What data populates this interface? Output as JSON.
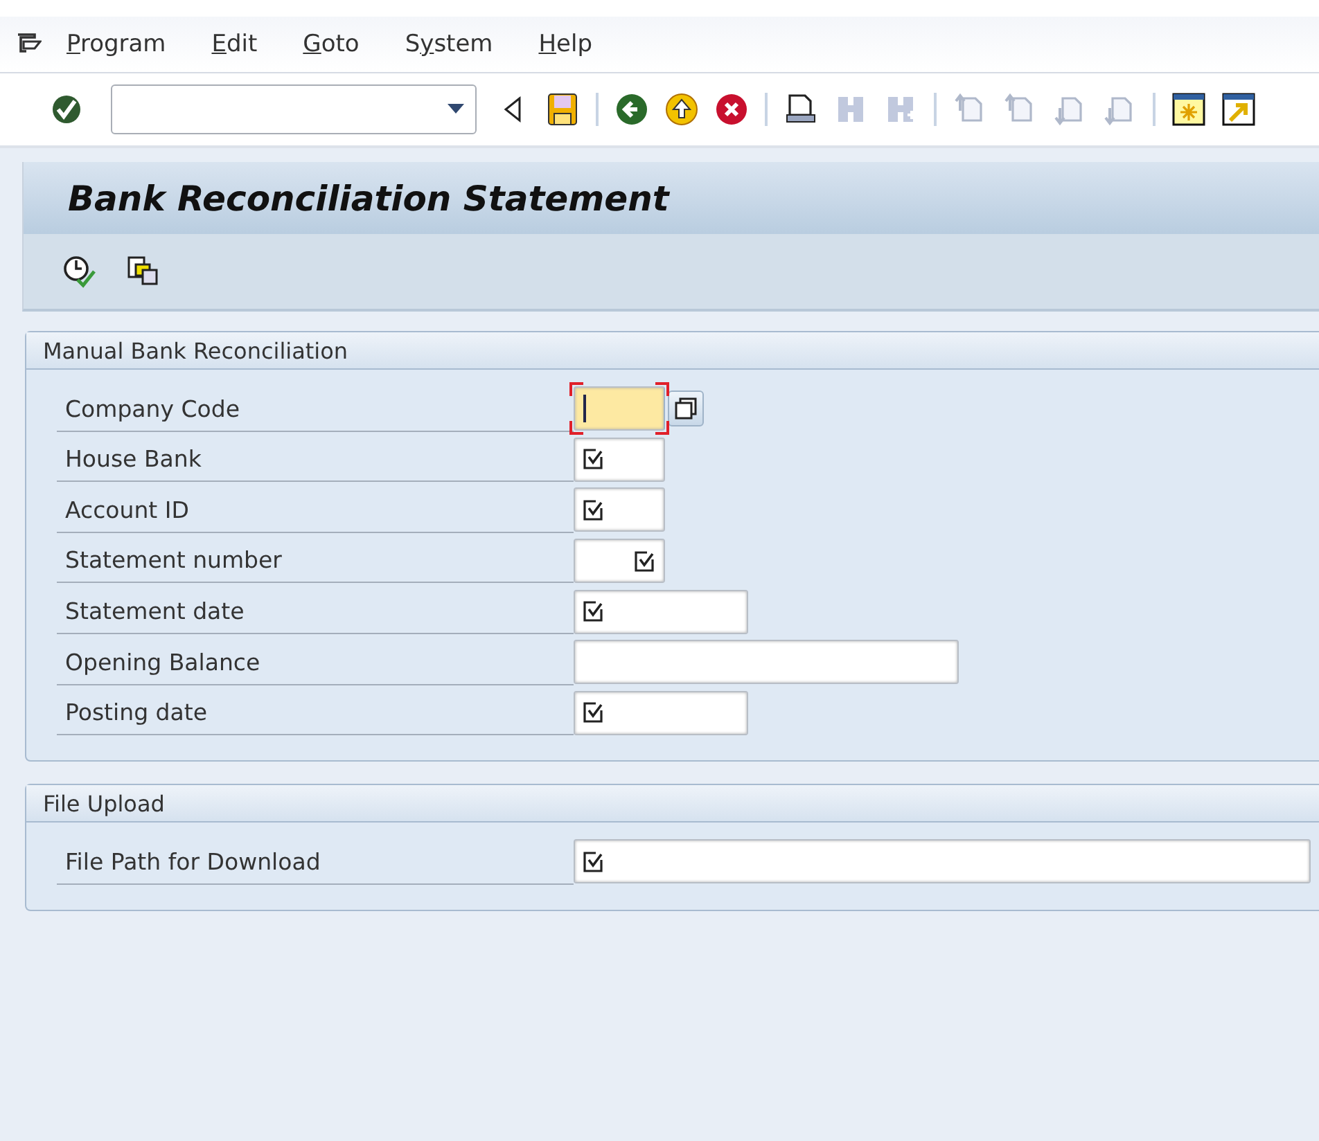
{
  "menu": [
    {
      "key": "P",
      "after": "rogram"
    },
    {
      "key": "E",
      "after": "dit"
    },
    {
      "key": "G",
      "after": "oto"
    },
    {
      "before": "S",
      "key": "y",
      "after": "stem"
    },
    {
      "key": "H",
      "after": "elp"
    }
  ],
  "toolbar": {
    "buttons": [
      {
        "kind": "enter",
        "disabled": false
      },
      {
        "kind": "field"
      },
      {
        "kind": "back-arrow",
        "disabled": false
      },
      {
        "kind": "save",
        "disabled": false
      },
      {
        "kind": "sep"
      },
      {
        "kind": "back",
        "disabled": false
      },
      {
        "kind": "exit",
        "disabled": false
      },
      {
        "kind": "cancel",
        "disabled": false
      },
      {
        "kind": "sep"
      },
      {
        "kind": "print",
        "disabled": false
      },
      {
        "kind": "find",
        "disabled": true
      },
      {
        "kind": "find-next",
        "disabled": true
      },
      {
        "kind": "sep"
      },
      {
        "kind": "first",
        "disabled": true
      },
      {
        "kind": "prev",
        "disabled": true
      },
      {
        "kind": "next",
        "disabled": true
      },
      {
        "kind": "last",
        "disabled": true
      },
      {
        "kind": "sep"
      },
      {
        "kind": "new-session",
        "disabled": false
      },
      {
        "kind": "shortcut",
        "disabled": false
      }
    ]
  },
  "title": "Bank Reconciliation Statement",
  "app_toolbar": [
    {
      "kind": "execute"
    },
    {
      "kind": "variants"
    }
  ],
  "groups": [
    {
      "title": "Manual Bank Reconciliation",
      "fields": [
        {
          "label": "Company Code",
          "kind": "short",
          "required": false,
          "focused": true,
          "value_help": true
        },
        {
          "label": "House Bank",
          "kind": "short",
          "required": true,
          "focused": false,
          "value_help": false
        },
        {
          "label": "Account ID",
          "kind": "short",
          "required": true,
          "focused": false,
          "value_help": false
        },
        {
          "label": "Statement number",
          "kind": "numeric",
          "required": true,
          "focused": false,
          "value_help": false
        },
        {
          "label": "Statement date",
          "kind": "medium",
          "required": true,
          "focused": false,
          "value_help": false
        },
        {
          "label": "Opening Balance",
          "kind": "long",
          "required": false,
          "focused": false,
          "value_help": false
        },
        {
          "label": "Posting date",
          "kind": "medium",
          "required": true,
          "focused": false,
          "value_help": false
        }
      ]
    },
    {
      "title": "File Upload",
      "fields": [
        {
          "label": "File Path for Download",
          "kind": "wide",
          "required": true,
          "focused": false,
          "value_help": false
        }
      ]
    }
  ]
}
